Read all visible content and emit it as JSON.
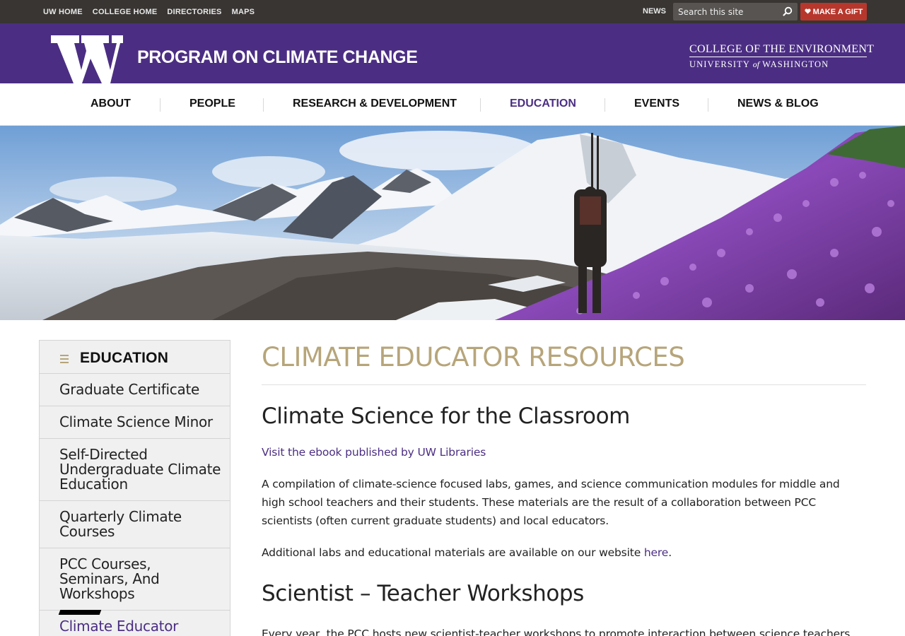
{
  "topbar": {
    "links": [
      "UW HOME",
      "COLLEGE HOME",
      "DIRECTORIES",
      "MAPS"
    ],
    "news": "NEWS",
    "search_placeholder": "Search this site",
    "gift_label": "MAKE A GIFT"
  },
  "header": {
    "site_title": "PROGRAM ON CLIMATE CHANGE",
    "college_line1": "COLLEGE OF THE ENVIRONMENT",
    "college_line2_a": "UNIVERSITY",
    "college_line2_of": "of",
    "college_line2_b": "WASHINGTON"
  },
  "nav": {
    "items": [
      {
        "label": "ABOUT"
      },
      {
        "label": "PEOPLE"
      },
      {
        "label": "RESEARCH & DEVELOPMENT"
      },
      {
        "label": "EDUCATION"
      },
      {
        "label": "EVENTS"
      },
      {
        "label": "NEWS & BLOG"
      }
    ],
    "active": "EDUCATION"
  },
  "sidebar": {
    "title": "EDUCATION",
    "items": [
      {
        "label": "Graduate Certificate"
      },
      {
        "label": "Climate Science Minor"
      },
      {
        "label": "Self-Directed Undergraduate Climate Education"
      },
      {
        "label": "Quarterly Climate Courses"
      },
      {
        "label": "PCC Courses, Seminars, And Workshops"
      },
      {
        "label": "Climate Educator"
      }
    ]
  },
  "content": {
    "page_title": "CLIMATE EDUCATOR RESOURCES",
    "section1_heading": "Climate Science for the Classroom",
    "ebook_link": "Visit the ebook published by UW Libraries",
    "para1": "A compilation of climate-science focused labs, games, and science communication modules for middle and high school teachers and their students. These materials are the result of a collaboration between PCC scientists (often current graduate students) and local educators.",
    "para2_prefix": "Additional labs and educational materials are available on our website ",
    "para2_link": "here",
    "para2_suffix": ".",
    "section2_heading": "Scientist – Teacher Workshops",
    "para3": "Every year, the PCC hosts new scientist-teacher workshops to promote interaction between science teachers and"
  },
  "colors": {
    "uw_purple": "#4b2e83",
    "uw_gold": "#b7a57a",
    "topbar": "#383533",
    "gift_red": "#b7372d"
  }
}
